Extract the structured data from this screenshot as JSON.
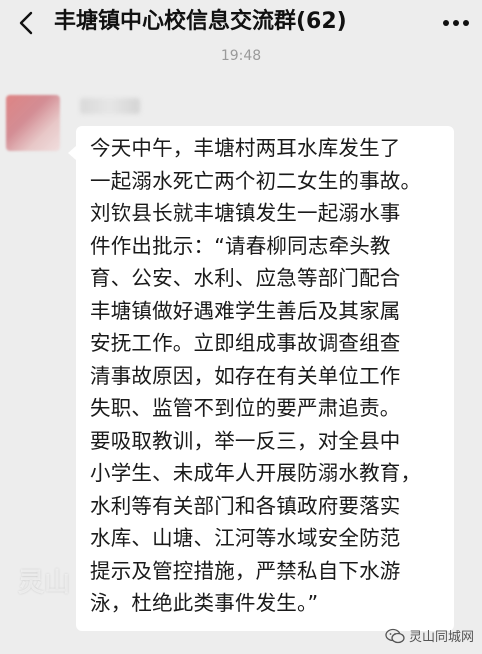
{
  "header": {
    "title": "丰塘镇中心校信息交流群(62)"
  },
  "timestamp": "19:48",
  "message": {
    "text": "今天中午，丰塘村两耳水库发生了\n一起溺水死亡两个初二女生的事故。\n刘钦县长就丰塘镇发生一起溺水事\n件作出批示：“请春柳同志牵头教\n育、公安、水利、应急等部门配合\n丰塘镇做好遇难学生善后及其家属\n安抚工作。立即组成事故调查组查\n清事故原因，如存在有关单位工作\n失职、监管不到位的要严肃追责。\n要吸取教训，举一反三，对全县中\n小学生、未成年人开展防溺水教育，\n水利等有关部门和各镇政府要落实\n水库、山塘、江河等水域安全防范\n提示及管控措施，严禁私自下水游\n泳，杜绝此类事件发生。”"
  },
  "watermarks": {
    "left": "灵山",
    "right": "灵山同城网"
  },
  "icons": {
    "back": "chevron-left-icon",
    "more": "more-icon",
    "wechat": "wechat-icon"
  }
}
